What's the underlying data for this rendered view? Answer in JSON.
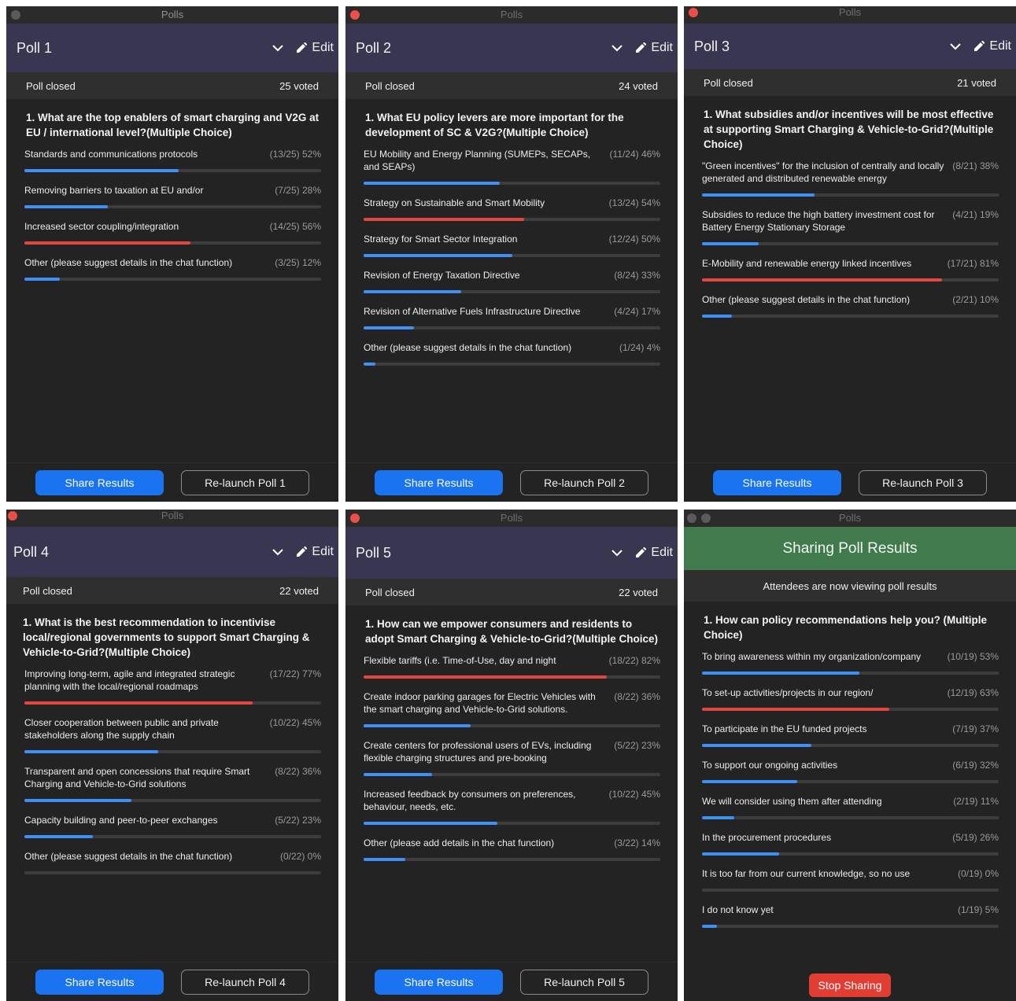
{
  "window_title": "Polls",
  "edit_label": "Edit",
  "share_label": "Share Results",
  "colors": {
    "blue": "#3f8ff5",
    "red": "#e2463e",
    "header": "#383650",
    "share_green": "#3f7b4b"
  },
  "polls": [
    {
      "title": "Poll 1",
      "status": "Poll closed",
      "voted": "25 voted",
      "question": "1. What are the top enablers of smart charging and V2G at EU / international level?(Multiple Choice)",
      "relaunch_label": "Re-launch Poll 1",
      "options": [
        {
          "label": "Standards and communications protocols",
          "stat": "(13/25) 52%",
          "percent": 52,
          "color": "blue"
        },
        {
          "label": "Removing barriers to taxation at EU and/or",
          "stat": "(7/25) 28%",
          "percent": 28,
          "color": "blue"
        },
        {
          "label": "Increased sector coupling/integration",
          "stat": "(14/25) 56%",
          "percent": 56,
          "color": "red"
        },
        {
          "label": "Other (please suggest details in the chat function)",
          "stat": "(3/25) 12%",
          "percent": 12,
          "color": "blue"
        }
      ]
    },
    {
      "title": "Poll 2",
      "status": "Poll closed",
      "voted": "24 voted",
      "question": "1. What EU policy levers are more important for the development of SC & V2G?(Multiple Choice)",
      "relaunch_label": "Re-launch Poll 2",
      "options": [
        {
          "label": "EU Mobility and Energy Planning (SUMEPs, SECAPs, and SEAPs)",
          "stat": "(11/24) 46%",
          "percent": 46,
          "color": "blue"
        },
        {
          "label": "Strategy on Sustainable and Smart Mobility",
          "stat": "(13/24) 54%",
          "percent": 54,
          "color": "red"
        },
        {
          "label": "Strategy for Smart Sector Integration",
          "stat": "(12/24) 50%",
          "percent": 50,
          "color": "blue"
        },
        {
          "label": "Revision of Energy Taxation Directive",
          "stat": "(8/24) 33%",
          "percent": 33,
          "color": "blue"
        },
        {
          "label": "Revision of Alternative Fuels Infrastructure Directive",
          "stat": "(4/24) 17%",
          "percent": 17,
          "color": "blue"
        },
        {
          "label": "Other (please suggest details in the chat function)",
          "stat": "(1/24) 4%",
          "percent": 4,
          "color": "blue"
        }
      ]
    },
    {
      "title": "Poll 3",
      "status": "Poll closed",
      "voted": "21 voted",
      "question": "1. What subsidies and/or incentives will be most effective at supporting Smart Charging & Vehicle-to-Grid?(Multiple Choice)",
      "relaunch_label": "Re-launch Poll 3",
      "options": [
        {
          "label": "\"Green incentives\" for the inclusion of centrally and locally generated and distributed renewable energy",
          "stat": "(8/21) 38%",
          "percent": 38,
          "color": "blue"
        },
        {
          "label": "Subsidies to reduce the high battery investment cost for Battery Energy Stationary Storage",
          "stat": "(4/21) 19%",
          "percent": 19,
          "color": "blue"
        },
        {
          "label": "E-Mobility and renewable energy linked incentives",
          "stat": "(17/21) 81%",
          "percent": 81,
          "color": "red"
        },
        {
          "label": "Other (please suggest details in the chat function)",
          "stat": "(2/21) 10%",
          "percent": 10,
          "color": "blue"
        }
      ]
    },
    {
      "title": "Poll 4",
      "status": "Poll closed",
      "voted": "22 voted",
      "question": "1. What is the best recommendation to incentivise local/regional governments to support Smart Charging & Vehicle-to-Grid?(Multiple Choice)",
      "relaunch_label": "Re-launch Poll 4",
      "options": [
        {
          "label": "Improving long-term, agile and integrated strategic planning with the local/regional roadmaps",
          "stat": "(17/22) 77%",
          "percent": 77,
          "color": "red"
        },
        {
          "label": "Closer cooperation between public and private stakeholders along the supply chain",
          "stat": "(10/22) 45%",
          "percent": 45,
          "color": "blue"
        },
        {
          "label": "Transparent and open concessions that require Smart Charging and Vehicle-to-Grid solutions",
          "stat": "(8/22) 36%",
          "percent": 36,
          "color": "blue"
        },
        {
          "label": "Capacity building and peer-to-peer exchanges",
          "stat": "(5/22) 23%",
          "percent": 23,
          "color": "blue"
        },
        {
          "label": "Other (please suggest details in the chat function)",
          "stat": "(0/22) 0%",
          "percent": 0,
          "color": "blue"
        }
      ]
    },
    {
      "title": "Poll 5",
      "status": "Poll closed",
      "voted": "22 voted",
      "question": "1. How can we empower consumers and residents to adopt Smart Charging & Vehicle-to-Grid?(Multiple Choice)",
      "relaunch_label": "Re-launch Poll 5",
      "options": [
        {
          "label": "Flexible tariffs (i.e. Time-of-Use, day and night",
          "stat": "(18/22) 82%",
          "percent": 82,
          "color": "red"
        },
        {
          "label": "Create indoor parking garages for Electric Vehicles with the smart charging and Vehicle-to-Grid solutions.",
          "stat": "(8/22) 36%",
          "percent": 36,
          "color": "blue"
        },
        {
          "label": "Create centers for professional users of EVs, including flexible charging structures and pre-booking",
          "stat": "(5/22) 23%",
          "percent": 23,
          "color": "blue"
        },
        {
          "label": "Increased feedback by consumers on preferences, behaviour, needs, etc.",
          "stat": "(10/22) 45%",
          "percent": 45,
          "color": "blue"
        },
        {
          "label": "Other (please add details in the chat function)",
          "stat": "(3/22) 14%",
          "percent": 14,
          "color": "blue"
        }
      ]
    }
  ],
  "sharing": {
    "header": "Sharing Poll Results",
    "subheader": "Attendees are now viewing poll results",
    "question": "1. How can policy recommendations help you? (Multiple Choice)",
    "stop_label": "Stop Sharing",
    "options": [
      {
        "label": "To bring awareness within my organization/company",
        "stat": "(10/19) 53%",
        "percent": 53,
        "color": "blue"
      },
      {
        "label": "To set-up activities/projects in our region/",
        "stat": "(12/19) 63%",
        "percent": 63,
        "color": "red"
      },
      {
        "label": "To participate in the EU funded projects",
        "stat": "(7/19) 37%",
        "percent": 37,
        "color": "blue"
      },
      {
        "label": "To support our ongoing activities",
        "stat": "(6/19) 32%",
        "percent": 32,
        "color": "blue"
      },
      {
        "label": "We will consider using them after attending",
        "stat": "(2/19) 11%",
        "percent": 11,
        "color": "blue"
      },
      {
        "label": "In the procurement procedures",
        "stat": "(5/19) 26%",
        "percent": 26,
        "color": "blue"
      },
      {
        "label": "It is too far from our current knowledge, so no use",
        "stat": "(0/19) 0%",
        "percent": 0,
        "color": "blue"
      },
      {
        "label": "I do not know yet",
        "stat": "(1/19) 5%",
        "percent": 5,
        "color": "blue"
      }
    ]
  }
}
